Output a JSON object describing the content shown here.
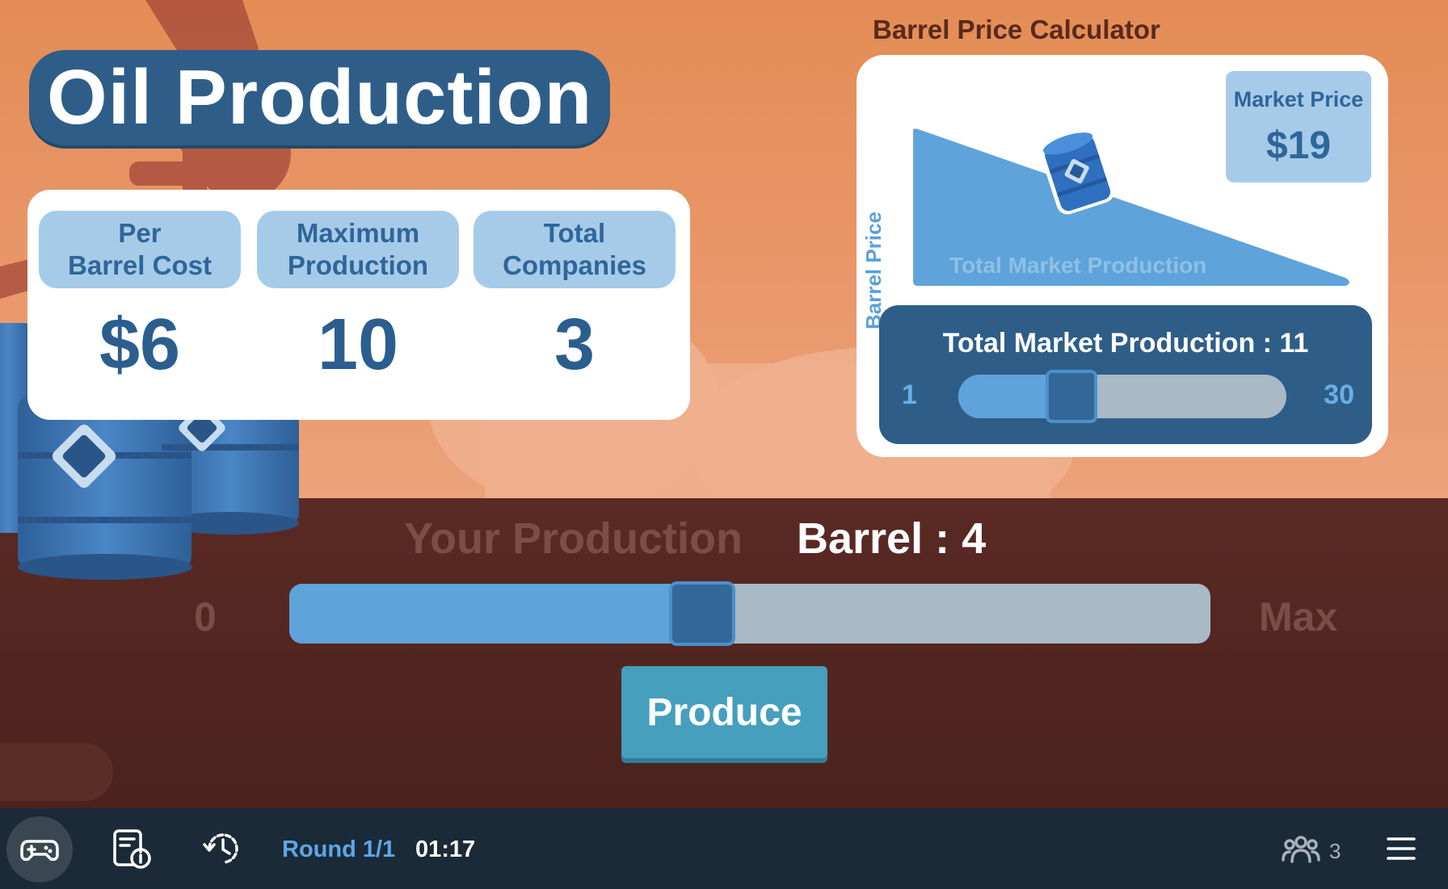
{
  "title": "Oil Production",
  "stats": [
    {
      "label": "Per\nBarrel Cost",
      "value": "$6"
    },
    {
      "label": "Maximum\nProduction",
      "value": "10"
    },
    {
      "label": "Total\nCompanies",
      "value": "3"
    }
  ],
  "calculator": {
    "title": "Barrel Price Calculator",
    "market_price_label": "Market Price",
    "market_price_value": "$19",
    "y_axis_label": "Barrel Price",
    "x_axis_label": "Total Market Production",
    "total_market_production_text": "Total Market Production : 11",
    "slider_min": "1",
    "slider_max": "30",
    "slider_value": 11,
    "slider_range": [
      1,
      30
    ]
  },
  "production": {
    "label": "Your Production",
    "barrel_text": "Barrel : 4",
    "min_label": "0",
    "max_label": "Max",
    "value": 4,
    "max_value": 9,
    "produce_label": "Produce"
  },
  "bottom_bar": {
    "round_text": "Round 1/1",
    "timer": "01:17",
    "players_count": "3",
    "icons": [
      "gamepad-icon",
      "report-info-icon",
      "timer-history-icon",
      "players-icon",
      "menu-icon"
    ]
  },
  "colors": {
    "accent_blue": "#2e5e88",
    "light_blue": "#a6cbe9",
    "slider_fill": "#5ea3da",
    "button": "#459fbd",
    "sky": "#e38c55",
    "ground": "#4b221d"
  }
}
